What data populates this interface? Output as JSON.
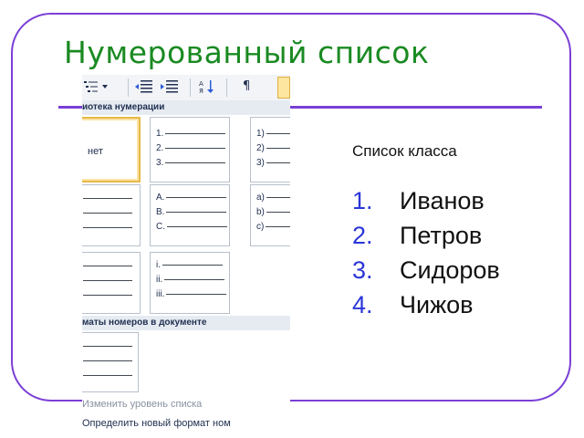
{
  "slide": {
    "title": "Нумерованный список",
    "list_caption": "Список класса",
    "list_items": [
      {
        "number": "1.",
        "text": "Иванов"
      },
      {
        "number": "2.",
        "text": "Петров"
      },
      {
        "number": "3.",
        "text": "Сидоров"
      },
      {
        "number": "4.",
        "text": "Чижов"
      }
    ]
  },
  "gallery": {
    "toolbar": {
      "multilevel_icon": "multilevel-list-icon",
      "decrease_indent_icon": "decrease-indent-icon",
      "increase_indent_icon": "increase-indent-icon",
      "sort_icon": "sort-icon",
      "paragraph_mark": "¶"
    },
    "library_header": "иотека нумерации",
    "none_label": "нет",
    "formats": [
      [
        "1.",
        "2.",
        "3."
      ],
      [
        "1)",
        "2)",
        "3)"
      ],
      [
        "A.",
        "B.",
        "C."
      ],
      [
        "a)",
        "b)",
        "c)"
      ],
      [
        "i.",
        "ii.",
        "iii."
      ]
    ],
    "document_formats_header": "маты номеров в документе",
    "menu": {
      "change_level": "Изменить уровень списка",
      "define_new": "Определить новый формат ном"
    },
    "colors": {
      "selection_border": "#e6b94a",
      "header_background": "#e6ebf2"
    }
  },
  "colors": {
    "title": "#1a8a22",
    "frame": "#7a3fd6",
    "list_number": "#2a35d8"
  }
}
